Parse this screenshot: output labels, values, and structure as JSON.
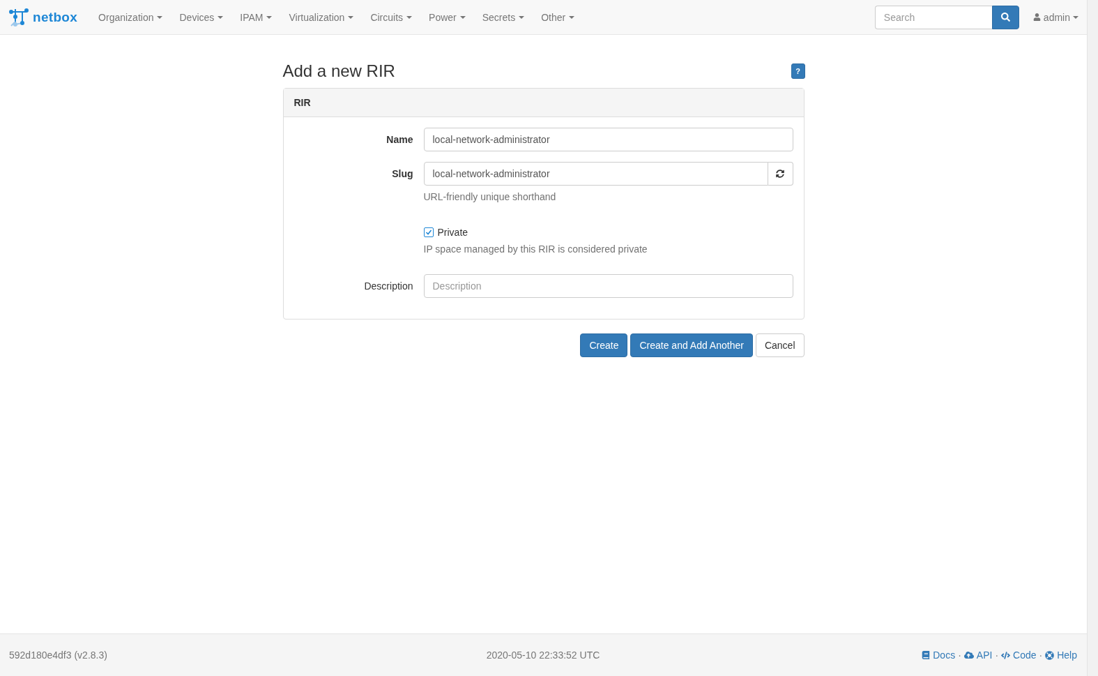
{
  "navbar": {
    "brand": "netbox",
    "menus": [
      {
        "label": "Organization"
      },
      {
        "label": "Devices"
      },
      {
        "label": "IPAM"
      },
      {
        "label": "Virtualization"
      },
      {
        "label": "Circuits"
      },
      {
        "label": "Power"
      },
      {
        "label": "Secrets"
      },
      {
        "label": "Other"
      }
    ],
    "search": {
      "placeholder": "Search"
    },
    "user": "admin"
  },
  "page": {
    "title": "Add a new RIR",
    "help": "?"
  },
  "panel": {
    "heading": "RIR",
    "fields": [
      {
        "kind": "text",
        "label": "Name",
        "required": true,
        "value": "local-network-administrator"
      },
      {
        "kind": "slug",
        "label": "Slug",
        "required": true,
        "value": "local-network-administrator",
        "help": "URL-friendly unique shorthand"
      },
      {
        "kind": "checkbox",
        "label": "Private",
        "checked": true,
        "help": "IP space managed by this RIR is considered private"
      },
      {
        "kind": "text",
        "label": "Description",
        "required": false,
        "placeholder": "Description"
      }
    ]
  },
  "buttons": [
    {
      "label": "Create",
      "kind": "primary"
    },
    {
      "label": "Create and Add Another",
      "kind": "primary"
    },
    {
      "label": "Cancel",
      "kind": "default"
    }
  ],
  "footer": {
    "version": "592d180e4df3 (v2.8.3)",
    "timestamp": "2020-05-10 22:33:52 UTC",
    "separator": "·",
    "links": [
      {
        "label": "Docs",
        "kind": "docs"
      },
      {
        "label": "API",
        "kind": "api"
      },
      {
        "label": "Code",
        "kind": "code"
      },
      {
        "label": "Help",
        "kind": "help"
      }
    ]
  }
}
